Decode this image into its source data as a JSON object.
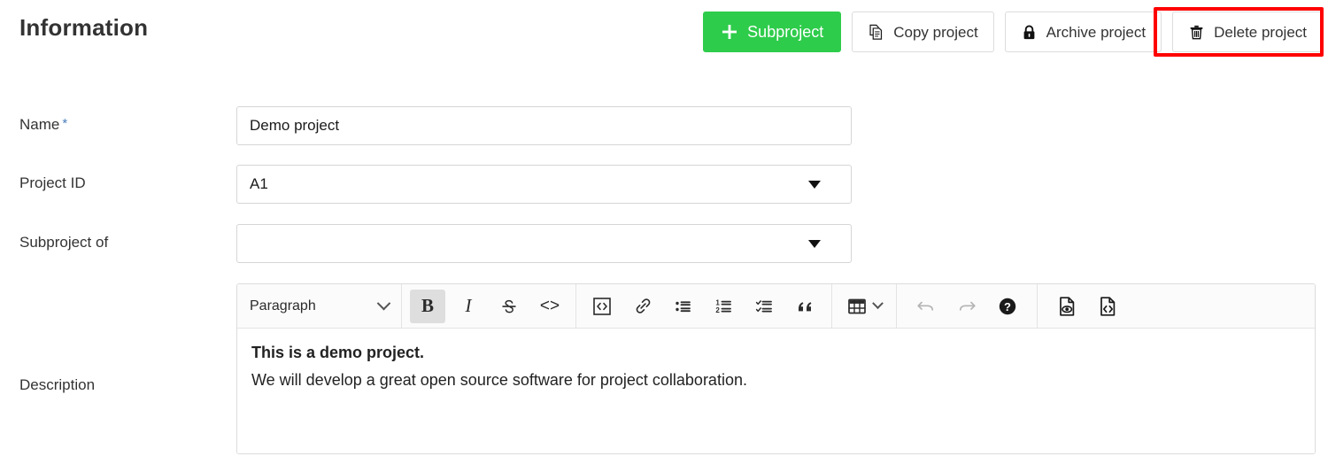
{
  "header": {
    "title": "Information",
    "actions": [
      {
        "id": "subproject",
        "label": "Subproject",
        "icon": "plus-icon",
        "style": "green"
      },
      {
        "id": "copy-project",
        "label": "Copy project",
        "icon": "copy-icon",
        "style": "default"
      },
      {
        "id": "archive-project",
        "label": "Archive project",
        "icon": "lock-icon",
        "style": "default"
      },
      {
        "id": "delete-project",
        "label": "Delete project",
        "icon": "trash-icon",
        "style": "default",
        "highlight": "#ff0000"
      }
    ]
  },
  "form": {
    "name": {
      "label": "Name",
      "required_marker": "*",
      "value": "Demo project",
      "placeholder": ""
    },
    "project_id": {
      "label": "Project ID",
      "value": "A1"
    },
    "subproject_of": {
      "label": "Subproject of",
      "value": ""
    },
    "description": {
      "label": "Description",
      "editor": {
        "style_select": "Paragraph",
        "tools": [
          {
            "id": "bold",
            "icon": "bold-icon",
            "glyph": "B",
            "state": "active"
          },
          {
            "id": "italic",
            "icon": "italic-icon",
            "glyph": "I",
            "state": "normal"
          },
          {
            "id": "strikethrough",
            "icon": "strikethrough-icon",
            "glyph": "S",
            "state": "normal"
          },
          {
            "id": "inline-code",
            "icon": "code-icon",
            "glyph": "<>",
            "state": "normal"
          },
          {
            "id": "code-block",
            "icon": "code-block-icon",
            "glyph": "<>",
            "state": "normal"
          },
          {
            "id": "link",
            "icon": "link-icon",
            "state": "normal"
          },
          {
            "id": "bullet-list",
            "icon": "bullet-list-icon",
            "state": "normal"
          },
          {
            "id": "ordered-list",
            "icon": "numbered-list-icon",
            "state": "normal"
          },
          {
            "id": "task-list",
            "icon": "task-list-icon",
            "state": "normal"
          },
          {
            "id": "blockquote",
            "icon": "quote-icon",
            "state": "normal"
          },
          {
            "id": "table",
            "icon": "table-icon",
            "state": "normal"
          },
          {
            "id": "undo",
            "icon": "undo-icon",
            "state": "disabled"
          },
          {
            "id": "redo",
            "icon": "redo-icon",
            "state": "disabled"
          },
          {
            "id": "help",
            "icon": "help-icon",
            "state": "normal"
          },
          {
            "id": "preview",
            "icon": "document-preview-icon",
            "state": "normal"
          },
          {
            "id": "source",
            "icon": "document-source-icon",
            "state": "normal"
          }
        ],
        "content": [
          {
            "text": "This is a demo project.",
            "bold": true
          },
          {
            "text": "We will develop a great open source software for project collaboration.",
            "bold": false
          }
        ]
      }
    }
  },
  "colors": {
    "accent_green": "#2ecc4b",
    "highlight_red": "#ff0000",
    "required_blue": "#4a7ebb",
    "border_gray": "#dcdcdc"
  }
}
